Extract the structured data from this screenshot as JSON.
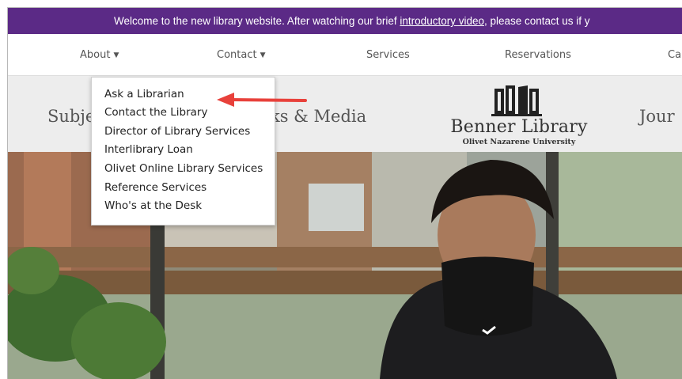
{
  "announcement": {
    "text_before": "Welcome to the new library website. After watching our brief ",
    "link": "introductory video",
    "text_after": ", please contact us if y"
  },
  "nav": {
    "about": "About",
    "contact": "Contact",
    "services": "Services",
    "reservations": "Reservations",
    "overflow": "Ca"
  },
  "quick_links": {
    "subjects": "Subje",
    "books_media": "ks & Media",
    "journals": "Jour"
  },
  "logo": {
    "name": "Benner Library",
    "subtitle": "Olivet Nazarene University"
  },
  "contact_menu": {
    "items": [
      "Ask a Librarian",
      "Contact the Library",
      "Director of Library Services",
      "Interlibrary Loan",
      "Olivet Online Library Services",
      "Reference Services",
      "Who's at the Desk"
    ]
  },
  "colors": {
    "brand_purple": "#5b2a86",
    "arrow_red": "#e8413b"
  },
  "icons": [
    "chevron-down-icon",
    "book-logo-icon",
    "red-arrow-annotation"
  ]
}
